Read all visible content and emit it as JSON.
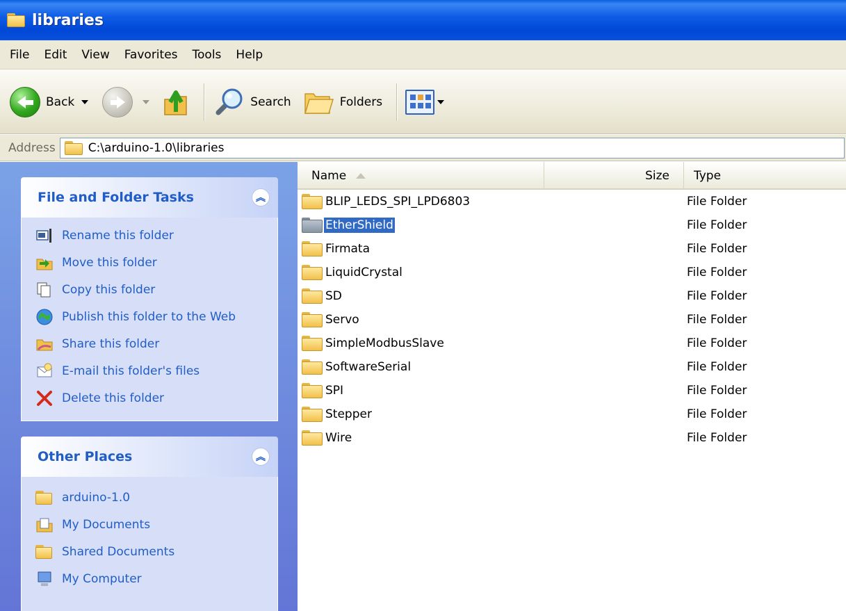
{
  "window": {
    "title": "libraries"
  },
  "menu": [
    "File",
    "Edit",
    "View",
    "Favorites",
    "Tools",
    "Help"
  ],
  "toolbar": {
    "back_label": "Back",
    "search_label": "Search",
    "folders_label": "Folders"
  },
  "address": {
    "label": "Address",
    "path": "C:\\arduino-1.0\\libraries"
  },
  "task_pane": {
    "file_tasks": {
      "title": "File and Folder Tasks",
      "items": [
        {
          "label": "Rename this folder",
          "icon": "rename-icon"
        },
        {
          "label": "Move this folder",
          "icon": "move-icon"
        },
        {
          "label": "Copy this folder",
          "icon": "copy-icon"
        },
        {
          "label": "Publish this folder to the Web",
          "icon": "publish-web-icon"
        },
        {
          "label": "Share this folder",
          "icon": "share-icon"
        },
        {
          "label": "E-mail this folder's files",
          "icon": "email-icon"
        },
        {
          "label": "Delete this folder",
          "icon": "delete-icon"
        }
      ]
    },
    "other_places": {
      "title": "Other Places",
      "items": [
        {
          "label": "arduino-1.0",
          "icon": "folder-icon"
        },
        {
          "label": "My Documents",
          "icon": "my-documents-icon"
        },
        {
          "label": "Shared Documents",
          "icon": "folder-icon"
        },
        {
          "label": "My Computer",
          "icon": "computer-icon"
        }
      ]
    }
  },
  "file_list": {
    "columns": {
      "name": "Name",
      "size": "Size",
      "type": "Type"
    },
    "rows": [
      {
        "name": "BLIP_LEDS_SPI_LPD6803",
        "type": "File Folder"
      },
      {
        "name": "EtherShield",
        "type": "File Folder",
        "selected": true
      },
      {
        "name": "Firmata",
        "type": "File Folder"
      },
      {
        "name": "LiquidCrystal",
        "type": "File Folder"
      },
      {
        "name": "SD",
        "type": "File Folder"
      },
      {
        "name": "Servo",
        "type": "File Folder"
      },
      {
        "name": "SimpleModbusSlave",
        "type": "File Folder"
      },
      {
        "name": "SoftwareSerial",
        "type": "File Folder"
      },
      {
        "name": "SPI",
        "type": "File Folder"
      },
      {
        "name": "Stepper",
        "type": "File Folder"
      },
      {
        "name": "Wire",
        "type": "File Folder"
      }
    ]
  },
  "colors": {
    "title_bar": "#0a52dd",
    "task_link": "#215dc6",
    "selection": "#316ac5",
    "pane_bg": "#7ba2e7"
  }
}
